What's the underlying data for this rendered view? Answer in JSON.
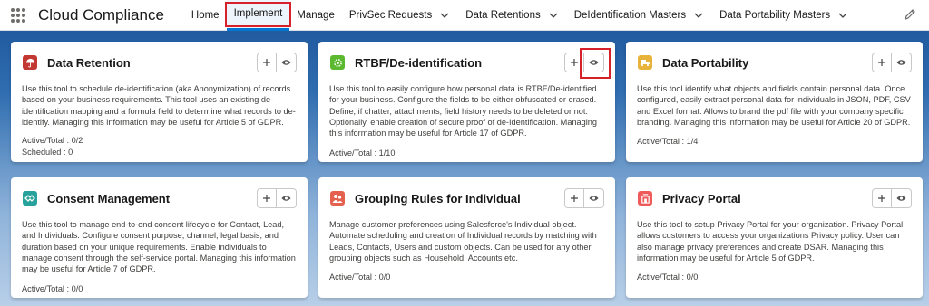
{
  "nav": {
    "app_name": "Cloud Compliance",
    "items": [
      {
        "label": "Home"
      },
      {
        "label": "Implement"
      },
      {
        "label": "Manage"
      },
      {
        "label": "PrivSec Requests"
      },
      {
        "label": "Data Retentions"
      },
      {
        "label": "DeIdentification Masters"
      },
      {
        "label": "Data Portability Masters"
      }
    ],
    "active_item": "Implement"
  },
  "cards": [
    {
      "title": "Data Retention",
      "icon": "umbrella-icon",
      "icon_color": "#c23934",
      "description": "Use this tool to schedule de-identification (aka Anonymization) of records based on your business requirements. This tool uses an existing de-identification mapping and a formula field to determine what records to de-identify. Managing this information may be useful for Article 5 of GDPR.",
      "stats": [
        "Active/Total : 0/2",
        "Scheduled : 0"
      ]
    },
    {
      "title": "RTBF/De-identification",
      "icon": "gear-icon",
      "icon_color": "#5ab92f",
      "description": "Use this tool to easily configure how personal data is RTBF/De-identified for your business. Configure the fields to be either obfuscated or erased. Define, if chatter, attachments, field history needs to be deleted or not. Optionally, enable creation of secure proof of de-Identification. Managing this information may be useful for Article 17 of GDPR.",
      "stats": [
        "Active/Total : 1/10"
      ]
    },
    {
      "title": "Data Portability",
      "icon": "truck-icon",
      "icon_color": "#e7b33b",
      "description": "Use this tool identify what objects and fields contain personal data. Once configured, easily extract personal data for individuals in JSON, PDF, CSV and Excel format. Allows to brand the pdf file with your company specific branding. Managing this information may be useful for Article 20 of GDPR.",
      "stats": [
        "Active/Total : 1/4"
      ]
    },
    {
      "title": "Consent Management",
      "icon": "handshake-icon",
      "icon_color": "#27a19c",
      "description": "Use this tool to manage end-to-end consent lifecycle for Contact, Lead, and Individuals. Configure consent purpose, channel, legal basis, and duration based on your unique requirements. Enable individuals to manage consent through the self-service portal. Managing this information may be useful for Article 7 of GDPR.",
      "stats": [
        "Active/Total : 0/0"
      ]
    },
    {
      "title": "Grouping Rules for Individual",
      "icon": "people-icon",
      "icon_color": "#e4614f",
      "description": "Manage customer preferences using Salesforce's Individual object. Automate scheduling and creation of Individual records by matching with Leads, Contacts, Users and custom objects. Can be used for any other grouping objects such as Household, Accounts etc.",
      "stats": [
        "Active/Total : 0/0"
      ]
    },
    {
      "title": "Privacy Portal",
      "icon": "portal-icon",
      "icon_color": "#ef5b5b",
      "description": "Use this tool to setup Privacy Portal for your organization. Privacy Portal allows customers to access your organizations Privacy policy. User can also manage privacy preferences and create DSAR. Managing this information may be useful for Article 5 of GDPR.",
      "stats": [
        "Active/Total : 0/0"
      ]
    }
  ],
  "highlight_color": "#d6212b"
}
